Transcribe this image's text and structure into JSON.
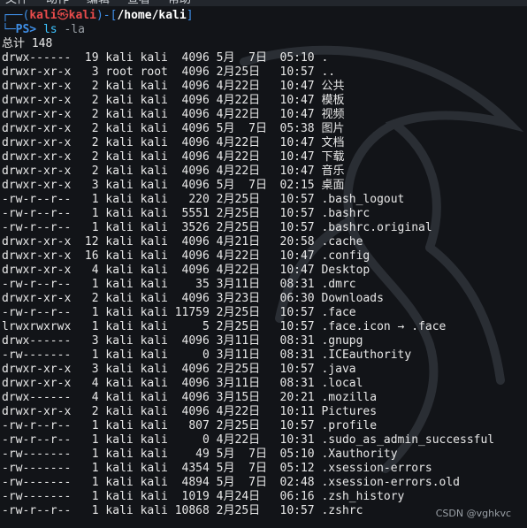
{
  "menubar": {
    "items": [
      "文件",
      "动作",
      "编辑",
      "查看",
      "帮助"
    ]
  },
  "prompt": {
    "open_bracket": "┌──(",
    "user": "kali",
    "at": "㉿",
    "host": "kali",
    "mid": ")-[",
    "path": "/home/kali",
    "close_bracket": "]",
    "second_prefix": "└─",
    "ps": "PS>",
    "command": "ls",
    "args": "-la"
  },
  "total_line": "总计 148",
  "rows": [
    {
      "perm": "drwx------",
      "links": "19",
      "owner": "kali",
      "group": "kali",
      "size": "4096",
      "date": "5月  7日",
      "time": "05:10",
      "name": "."
    },
    {
      "perm": "drwxr-xr-x",
      "links": "3",
      "owner": "root",
      "group": "root",
      "size": "4096",
      "date": "2月25日",
      "time": "10:57",
      "name": ".."
    },
    {
      "perm": "drwxr-xr-x",
      "links": "2",
      "owner": "kali",
      "group": "kali",
      "size": "4096",
      "date": "4月22日",
      "time": "10:47",
      "name": "公共"
    },
    {
      "perm": "drwxr-xr-x",
      "links": "2",
      "owner": "kali",
      "group": "kali",
      "size": "4096",
      "date": "4月22日",
      "time": "10:47",
      "name": "模板"
    },
    {
      "perm": "drwxr-xr-x",
      "links": "2",
      "owner": "kali",
      "group": "kali",
      "size": "4096",
      "date": "4月22日",
      "time": "10:47",
      "name": "视频"
    },
    {
      "perm": "drwxr-xr-x",
      "links": "2",
      "owner": "kali",
      "group": "kali",
      "size": "4096",
      "date": "5月  7日",
      "time": "05:38",
      "name": "图片"
    },
    {
      "perm": "drwxr-xr-x",
      "links": "2",
      "owner": "kali",
      "group": "kali",
      "size": "4096",
      "date": "4月22日",
      "time": "10:47",
      "name": "文档"
    },
    {
      "perm": "drwxr-xr-x",
      "links": "2",
      "owner": "kali",
      "group": "kali",
      "size": "4096",
      "date": "4月22日",
      "time": "10:47",
      "name": "下载"
    },
    {
      "perm": "drwxr-xr-x",
      "links": "2",
      "owner": "kali",
      "group": "kali",
      "size": "4096",
      "date": "4月22日",
      "time": "10:47",
      "name": "音乐"
    },
    {
      "perm": "drwxr-xr-x",
      "links": "3",
      "owner": "kali",
      "group": "kali",
      "size": "4096",
      "date": "5月  7日",
      "time": "02:15",
      "name": "桌面"
    },
    {
      "perm": "-rw-r--r--",
      "links": "1",
      "owner": "kali",
      "group": "kali",
      "size": "220",
      "date": "2月25日",
      "time": "10:57",
      "name": ".bash_logout"
    },
    {
      "perm": "-rw-r--r--",
      "links": "1",
      "owner": "kali",
      "group": "kali",
      "size": "5551",
      "date": "2月25日",
      "time": "10:57",
      "name": ".bashrc"
    },
    {
      "perm": "-rw-r--r--",
      "links": "1",
      "owner": "kali",
      "group": "kali",
      "size": "3526",
      "date": "2月25日",
      "time": "10:57",
      "name": ".bashrc.original"
    },
    {
      "perm": "drwxr-xr-x",
      "links": "12",
      "owner": "kali",
      "group": "kali",
      "size": "4096",
      "date": "4月21日",
      "time": "20:58",
      "name": ".cache"
    },
    {
      "perm": "drwxr-xr-x",
      "links": "16",
      "owner": "kali",
      "group": "kali",
      "size": "4096",
      "date": "4月22日",
      "time": "10:47",
      "name": ".config"
    },
    {
      "perm": "drwxr-xr-x",
      "links": "4",
      "owner": "kali",
      "group": "kali",
      "size": "4096",
      "date": "4月22日",
      "time": "10:47",
      "name": "Desktop"
    },
    {
      "perm": "-rw-r--r--",
      "links": "1",
      "owner": "kali",
      "group": "kali",
      "size": "35",
      "date": "3月11日",
      "time": "08:31",
      "name": ".dmrc"
    },
    {
      "perm": "drwxr-xr-x",
      "links": "2",
      "owner": "kali",
      "group": "kali",
      "size": "4096",
      "date": "3月23日",
      "time": "06:30",
      "name": "Downloads"
    },
    {
      "perm": "-rw-r--r--",
      "links": "1",
      "owner": "kali",
      "group": "kali",
      "size": "11759",
      "date": "2月25日",
      "time": "10:57",
      "name": ".face"
    },
    {
      "perm": "lrwxrwxrwx",
      "links": "1",
      "owner": "kali",
      "group": "kali",
      "size": "5",
      "date": "2月25日",
      "time": "10:57",
      "name": ".face.icon → .face"
    },
    {
      "perm": "drwx------",
      "links": "3",
      "owner": "kali",
      "group": "kali",
      "size": "4096",
      "date": "3月11日",
      "time": "08:31",
      "name": ".gnupg"
    },
    {
      "perm": "-rw-------",
      "links": "1",
      "owner": "kali",
      "group": "kali",
      "size": "0",
      "date": "3月11日",
      "time": "08:31",
      "name": ".ICEauthority"
    },
    {
      "perm": "drwxr-xr-x",
      "links": "3",
      "owner": "kali",
      "group": "kali",
      "size": "4096",
      "date": "2月25日",
      "time": "10:57",
      "name": ".java"
    },
    {
      "perm": "drwxr-xr-x",
      "links": "4",
      "owner": "kali",
      "group": "kali",
      "size": "4096",
      "date": "3月11日",
      "time": "08:31",
      "name": ".local"
    },
    {
      "perm": "drwx------",
      "links": "4",
      "owner": "kali",
      "group": "kali",
      "size": "4096",
      "date": "3月15日",
      "time": "20:21",
      "name": ".mozilla"
    },
    {
      "perm": "drwxr-xr-x",
      "links": "2",
      "owner": "kali",
      "group": "kali",
      "size": "4096",
      "date": "4月22日",
      "time": "10:11",
      "name": "Pictures"
    },
    {
      "perm": "-rw-r--r--",
      "links": "1",
      "owner": "kali",
      "group": "kali",
      "size": "807",
      "date": "2月25日",
      "time": "10:57",
      "name": ".profile"
    },
    {
      "perm": "-rw-r--r--",
      "links": "1",
      "owner": "kali",
      "group": "kali",
      "size": "0",
      "date": "4月22日",
      "time": "10:31",
      "name": ".sudo_as_admin_successful"
    },
    {
      "perm": "-rw-------",
      "links": "1",
      "owner": "kali",
      "group": "kali",
      "size": "49",
      "date": "5月  7日",
      "time": "05:10",
      "name": ".Xauthority"
    },
    {
      "perm": "-rw-------",
      "links": "1",
      "owner": "kali",
      "group": "kali",
      "size": "4354",
      "date": "5月  7日",
      "time": "05:12",
      "name": ".xsession-errors"
    },
    {
      "perm": "-rw-------",
      "links": "1",
      "owner": "kali",
      "group": "kali",
      "size": "4894",
      "date": "5月  7日",
      "time": "02:48",
      "name": ".xsession-errors.old"
    },
    {
      "perm": "-rw-------",
      "links": "1",
      "owner": "kali",
      "group": "kali",
      "size": "1019",
      "date": "4月24日",
      "time": "06:16",
      "name": ".zsh_history"
    },
    {
      "perm": "-rw-r--r--",
      "links": "1",
      "owner": "kali",
      "group": "kali",
      "size": "10868",
      "date": "2月25日",
      "time": "10:57",
      "name": ".zshrc"
    }
  ],
  "watermark_text": "CSDN @vghkvc",
  "colors": {
    "background": "#121418",
    "prompt_blue": "#3f8fe8",
    "prompt_red": "#e84b4b",
    "command": "#3cc3ff",
    "text": "#e8e8e8"
  }
}
